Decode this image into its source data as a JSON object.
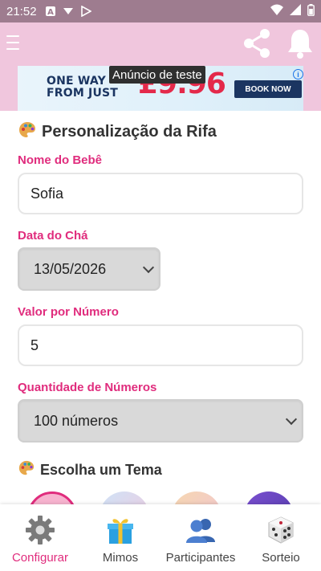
{
  "status_bar": {
    "time": "21:52"
  },
  "ad": {
    "headline_line1": "ONE WAY",
    "headline_line2": "FROM JUST",
    "price": "£9.96",
    "cta": "BOOK NOW",
    "test_label": "Anúncio de teste"
  },
  "form": {
    "title": "Personalização da Rifa",
    "baby_name_label": "Nome do Bebê",
    "baby_name_value": "Sofia",
    "date_label": "Data do Chá",
    "date_value": "13/05/2026",
    "price_label": "Valor por Número",
    "price_value": "5",
    "quantity_label": "Quantidade de Números",
    "quantity_value": "100 números",
    "theme_title": "Escolha um Tema"
  },
  "nav": {
    "items": [
      {
        "label": "Configurar",
        "icon": "gear-icon",
        "active": true
      },
      {
        "label": "Mimos",
        "icon": "gift-icon",
        "active": false
      },
      {
        "label": "Participantes",
        "icon": "users-icon",
        "active": false
      },
      {
        "label": "Sorteio",
        "icon": "dice-icon",
        "active": false
      }
    ]
  },
  "colors": {
    "accent": "#e02c7d",
    "header": "#f0c6dd",
    "status_bar": "#9e7c8f"
  }
}
